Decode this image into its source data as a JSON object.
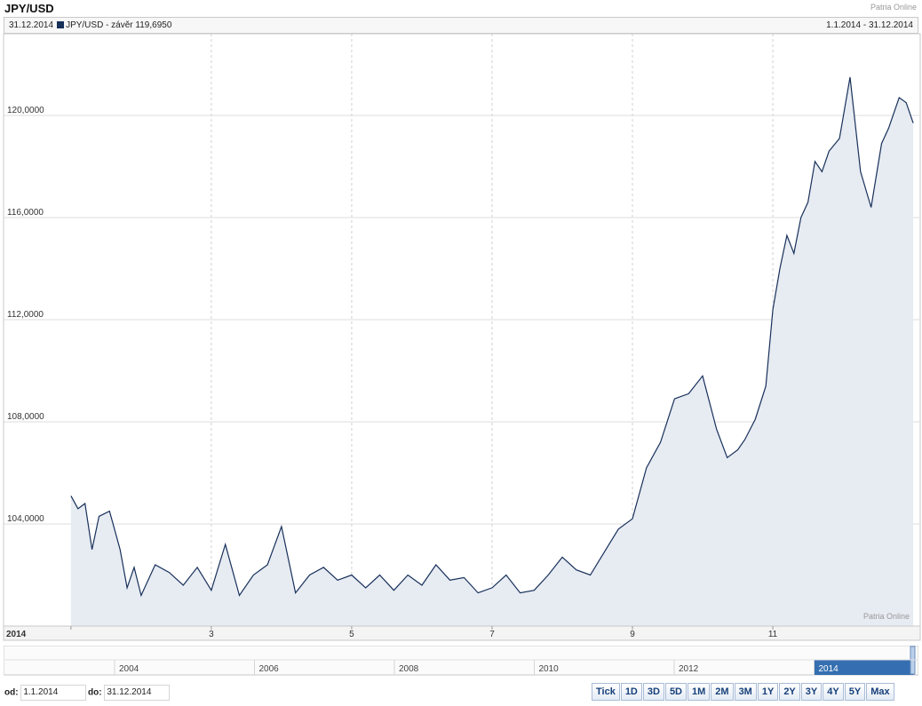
{
  "header": {
    "title": "JPY/USD",
    "source": "Patria Online"
  },
  "infobar": {
    "date": "31.12.2014",
    "series_label": "JPY/USD - závěr 119,6950",
    "range": "1.1.2014 - 31.12.2014"
  },
  "colors": {
    "line": "#17305a",
    "fill": "#e7ebf2",
    "navigator_fill": "#1f5fa8"
  },
  "chart_data": {
    "type": "area",
    "title": "JPY/USD",
    "ylim": [
      100,
      123.2
    ],
    "yticks": [
      104,
      108,
      112,
      116,
      120
    ],
    "ytick_labels": [
      "104,0000",
      "108,0000",
      "112,0000",
      "116,0000",
      "120,0000"
    ],
    "xlim": [
      1,
      13
    ],
    "xticks": [
      1,
      3,
      5,
      7,
      9,
      11
    ],
    "xtick_labels": [
      "2014",
      "3",
      "5",
      "7",
      "9",
      "11"
    ],
    "grid": true,
    "series": [
      {
        "x": [
          1.0,
          1.1,
          1.2,
          1.3,
          1.4,
          1.55,
          1.7,
          1.8,
          1.9,
          2.0,
          2.2,
          2.4,
          2.6,
          2.8,
          3.0,
          3.2,
          3.4,
          3.6,
          3.8,
          4.0,
          4.2,
          4.4,
          4.6,
          4.8,
          5.0,
          5.2,
          5.4,
          5.6,
          5.8,
          6.0,
          6.2,
          6.4,
          6.6,
          6.8,
          7.0,
          7.2,
          7.4,
          7.6,
          7.8,
          8.0,
          8.2,
          8.4,
          8.6,
          8.8,
          9.0,
          9.2,
          9.4,
          9.6,
          9.8,
          10.0,
          10.2,
          10.35,
          10.5,
          10.6,
          10.75,
          10.9,
          11.0,
          11.1,
          11.2,
          11.3,
          11.4,
          11.5,
          11.6,
          11.7,
          11.8,
          11.95,
          12.1,
          12.25,
          12.4,
          12.55,
          12.65,
          12.8,
          12.9,
          13.0
        ],
        "y": [
          105.1,
          104.6,
          104.8,
          103.0,
          104.3,
          104.5,
          103.0,
          101.5,
          102.3,
          101.2,
          102.4,
          102.1,
          101.6,
          102.3,
          101.4,
          103.2,
          101.2,
          102.0,
          102.4,
          103.9,
          101.3,
          102.0,
          102.3,
          101.8,
          102.0,
          101.5,
          102.0,
          101.4,
          102.0,
          101.6,
          102.4,
          101.8,
          101.9,
          101.3,
          101.5,
          102.0,
          101.3,
          101.4,
          102.0,
          102.7,
          102.2,
          102.0,
          102.9,
          103.8,
          104.2,
          106.2,
          107.2,
          108.9,
          109.1,
          109.8,
          107.7,
          106.6,
          106.9,
          107.3,
          108.1,
          109.4,
          112.4,
          114.0,
          115.3,
          114.6,
          116.0,
          116.6,
          118.2,
          117.8,
          118.6,
          119.1,
          121.5,
          117.8,
          116.4,
          118.9,
          119.5,
          120.7,
          120.5,
          119.7
        ]
      }
    ],
    "navigator": {
      "labels": [
        "2004",
        "2006",
        "2008",
        "2010",
        "2012",
        "2014"
      ],
      "selected": "2014"
    }
  },
  "controls": {
    "from_label": "od:",
    "from_value": "1.1.2014",
    "to_label": "do:",
    "to_value": "31.12.2014",
    "buttons": [
      "Tick",
      "1D",
      "3D",
      "5D",
      "1M",
      "2M",
      "3M",
      "1Y",
      "2Y",
      "3Y",
      "4Y",
      "5Y",
      "Max"
    ]
  }
}
